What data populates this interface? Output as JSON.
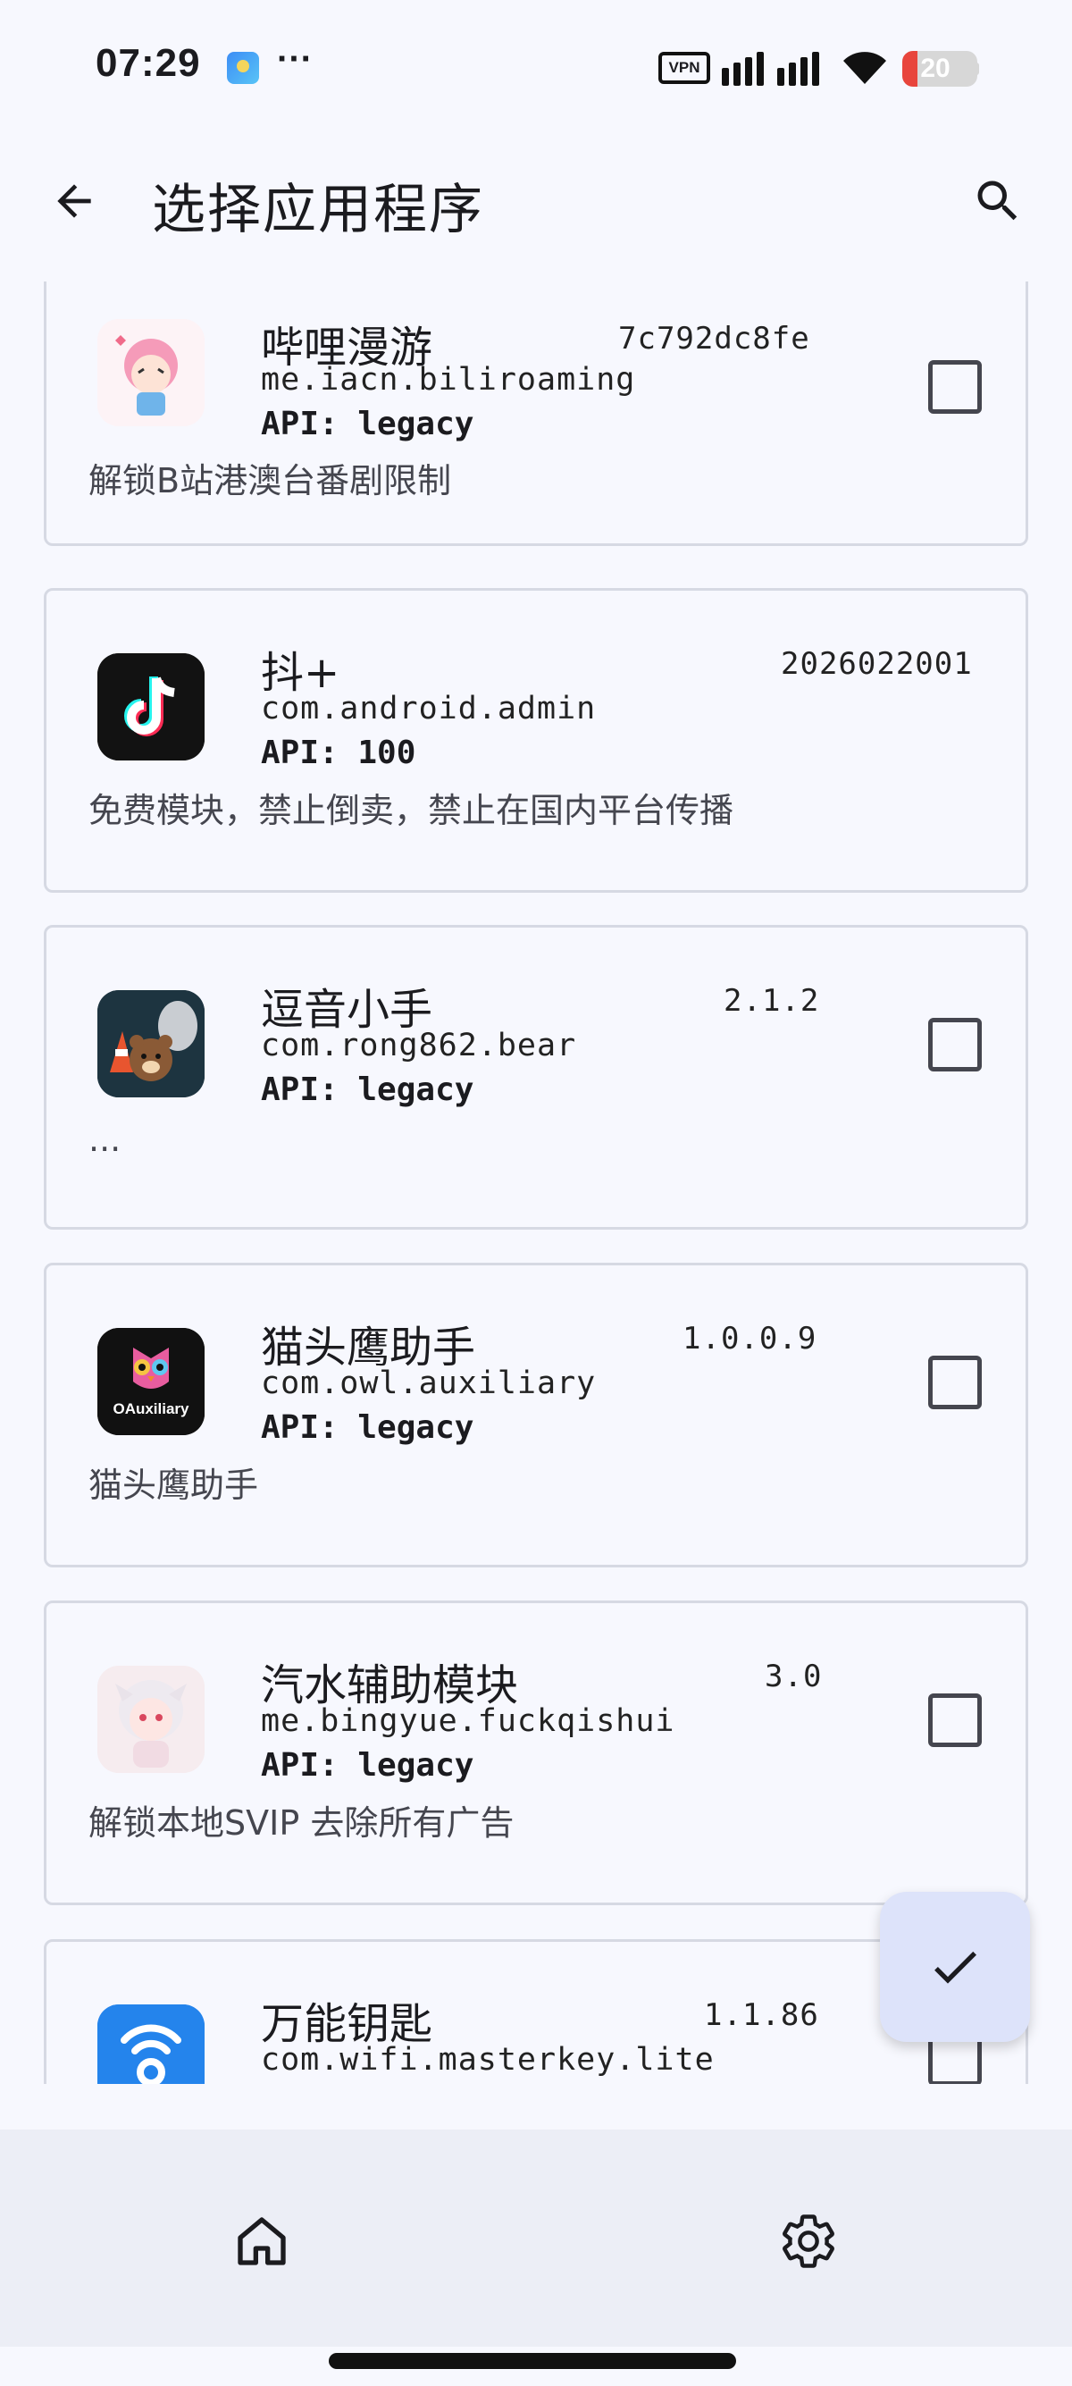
{
  "status_bar": {
    "time": "07:29",
    "more": "···",
    "vpn_label": "VPN",
    "battery_level": "20",
    "battery_fraction": 0.2,
    "battery_color": "#e8453c"
  },
  "app_bar": {
    "title": "选择应用程序",
    "back_icon": "arrow-back-icon",
    "search_icon": "search-icon"
  },
  "modules": [
    {
      "name": "哔哩漫游",
      "version": "7c792dc8fe",
      "package": "me.iacn.biliroaming",
      "api": "API: legacy",
      "description": "解锁B站港澳台番剧限制",
      "checked": false,
      "has_checkbox": true
    },
    {
      "name": "抖+",
      "version": "2026022001",
      "package": "com.android.admin",
      "api": "API: 100",
      "description": "免费模块，禁止倒卖，禁止在国内平台传播",
      "checked": false,
      "has_checkbox": false
    },
    {
      "name": "逗音小手",
      "version": "2.1.2",
      "package": "com.rong862.bear",
      "api": "API: legacy",
      "description": "...",
      "checked": false,
      "has_checkbox": true
    },
    {
      "name": "猫头鹰助手",
      "version": "1.0.0.9",
      "package": "com.owl.auxiliary",
      "api": "API: legacy",
      "description": "猫头鹰助手",
      "checked": false,
      "has_checkbox": true,
      "icon_text": "OAuxiliary"
    },
    {
      "name": "汽水辅助模块",
      "version": "3.0",
      "package": "me.bingyue.fuckqishui",
      "api": "API: legacy",
      "description": "解锁本地SVIP 去除所有广告",
      "checked": false,
      "has_checkbox": true
    },
    {
      "name": "万能钥匙",
      "version": "1.1.86",
      "package": "com.wifi.masterkey.lite",
      "api": "",
      "description": "",
      "checked": false,
      "has_checkbox": true
    }
  ],
  "fab": {
    "icon": "check-icon"
  },
  "bottom_nav": {
    "home_icon": "home-icon",
    "settings_icon": "gear-icon"
  },
  "colors": {
    "accent": "#dde3fa",
    "background": "#f7f8fe",
    "nav_background": "#eceef6"
  }
}
